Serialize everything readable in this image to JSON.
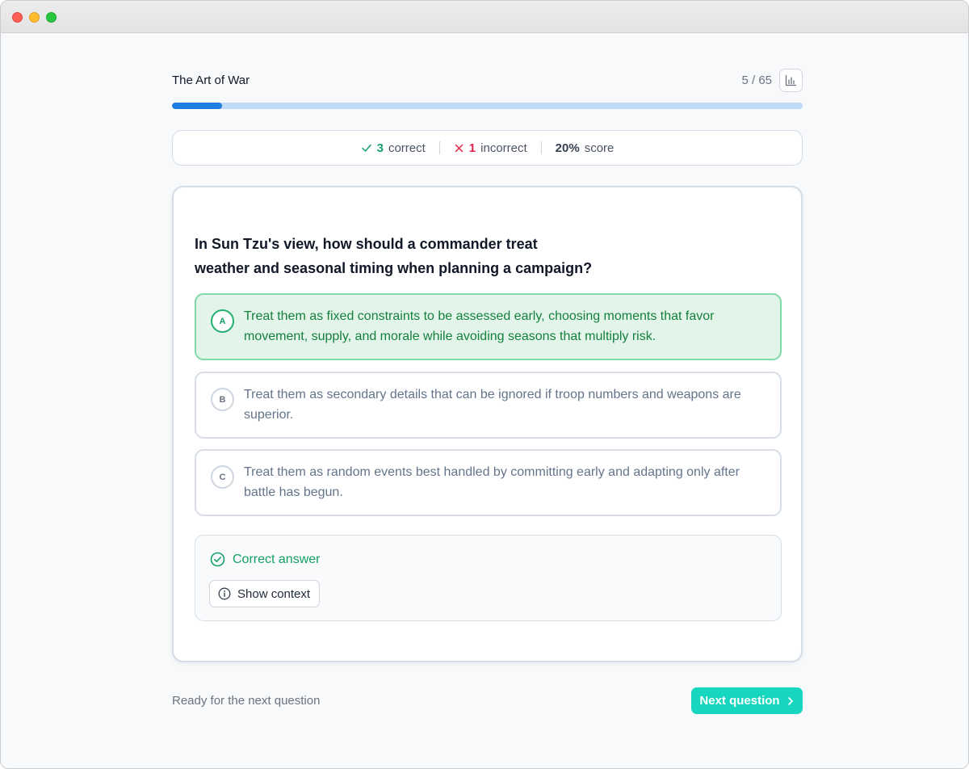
{
  "header": {
    "title": "The Art of War",
    "counter": "5 / 65",
    "stats_icon": "bar-chart-icon"
  },
  "progress": {
    "fraction": 0.08,
    "fill_color": "#1e7fe0",
    "track_color": "#bfdbf7"
  },
  "score": {
    "correct_count": "3",
    "correct_label": "correct",
    "incorrect_count": "1",
    "incorrect_label": "incorrect",
    "score_value": "20%",
    "score_label": "score"
  },
  "question": {
    "text_line1": "In Sun Tzu's view, how should a commander treat",
    "text_line2": "weather and seasonal timing when planning a campaign?"
  },
  "options": [
    {
      "letter": "A",
      "text": "Treat them as fixed constraints to be assessed early, choosing moments that favor movement, supply, and morale while avoiding seasons that multiply risk.",
      "state": "correct"
    },
    {
      "letter": "B",
      "text": "Treat them as secondary details that can be ignored if troop numbers and weapons are superior.",
      "state": "default"
    },
    {
      "letter": "C",
      "text": "Treat them as random events best handled by committing early and adapting only after battle has begun.",
      "state": "default"
    }
  ],
  "feedback": {
    "title": "Correct answer",
    "icon": "check-circle-icon",
    "context_button": "Show context",
    "context_icon": "info-icon"
  },
  "footer": {
    "status": "Ready for the next question",
    "next_label": "Next question",
    "next_icon": "chevron-right-icon"
  },
  "colors": {
    "accent_teal": "#17d6c0",
    "success_green": "#16a064",
    "error_red": "#e0244a"
  }
}
